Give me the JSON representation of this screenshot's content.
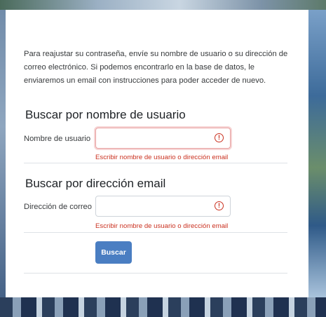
{
  "intro_text": "Para reajustar su contraseña, envíe su nombre de usuario o su dirección de correo electrónico. Si podemos encontrarlo en la base de datos, le enviaremos un email con instrucciones para poder acceder de nuevo.",
  "username_section": {
    "title": "Buscar por nombre de usuario",
    "label": "Nombre de usuario",
    "value": "",
    "warning_icon": "exclamation-circle-icon",
    "error": "Escribir nombre de usuario o dirección email"
  },
  "email_section": {
    "title": "Buscar por dirección email",
    "label": "Dirección de correo",
    "value": "",
    "warning_icon": "exclamation-circle-icon",
    "error": "Escribir nombre de usuario o dirección email"
  },
  "submit_label": "Buscar",
  "colors": {
    "accent": "#4a7ec2",
    "error": "#ca3120"
  }
}
